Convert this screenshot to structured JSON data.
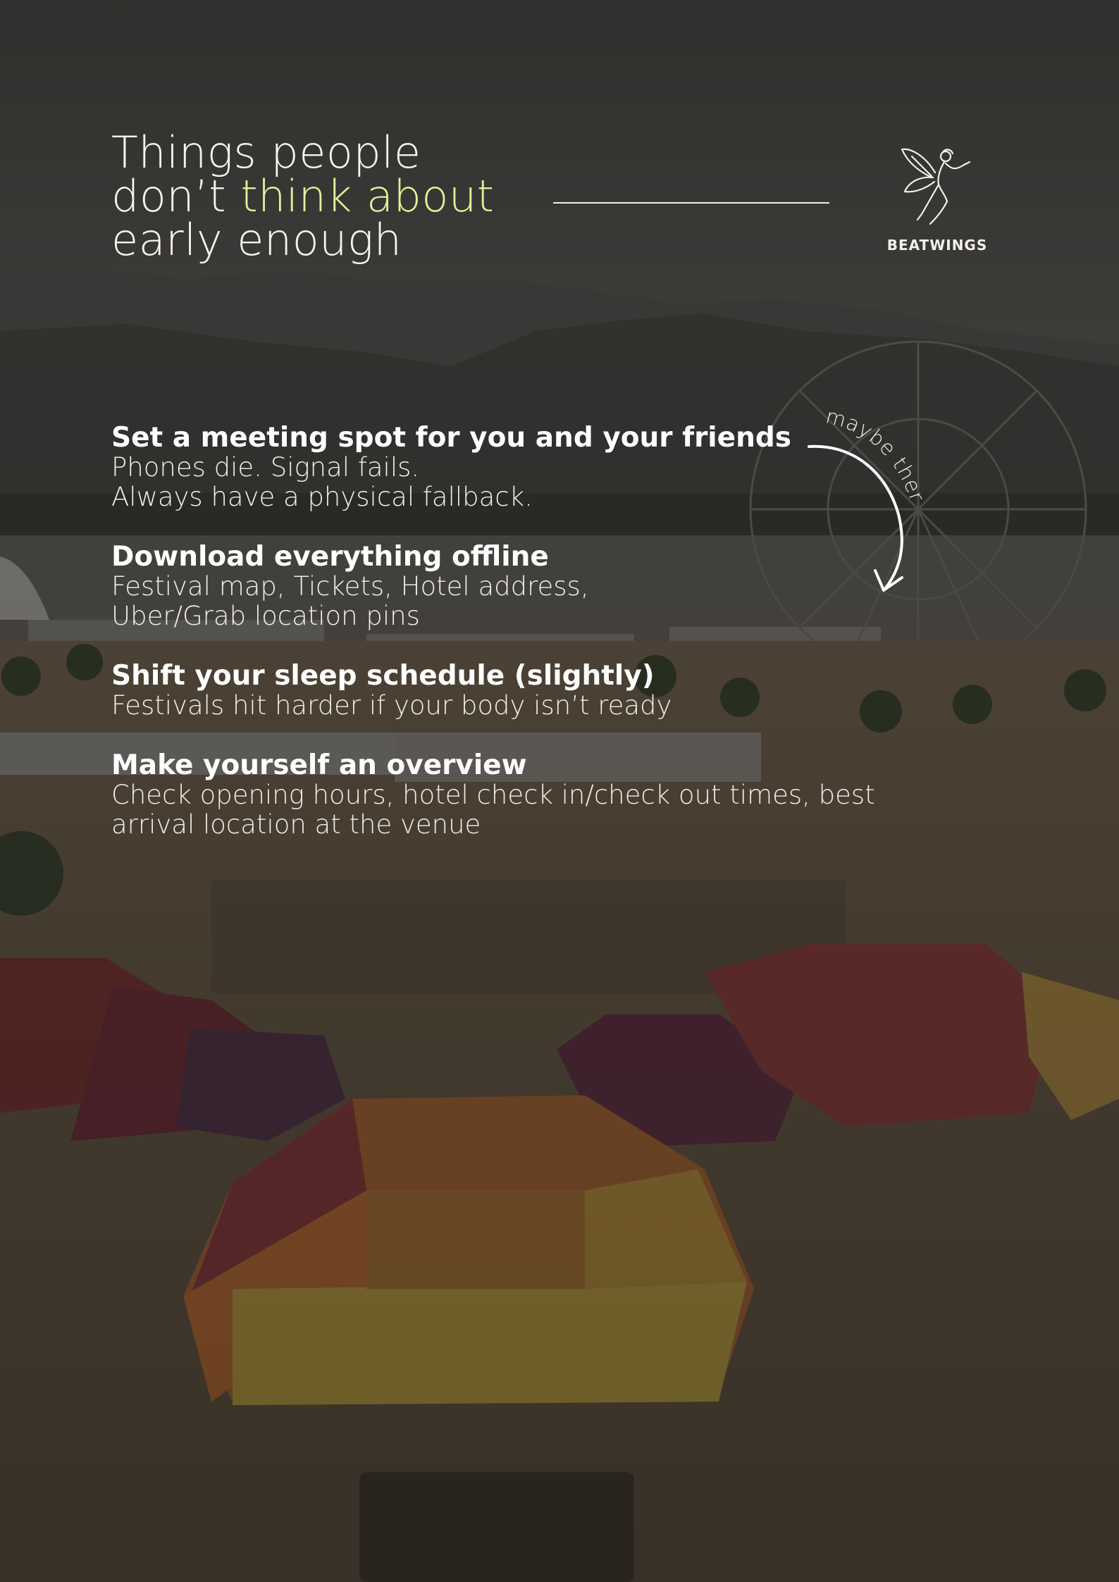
{
  "page": {
    "title_line1": "Things people",
    "title_line2_pre": "don’t ",
    "title_line2_accent": "think about",
    "title_line3": "early enough",
    "accent_color": "#e3f09a",
    "overlay_color": "#1e1d1b"
  },
  "logo": {
    "brand": "BEATWINGS",
    "icon": "fairy-icon"
  },
  "annotation": {
    "text": "maybe there",
    "icon": "curved-arrow-icon"
  },
  "tips": [
    {
      "heading": "Set a meeting spot for you and your friends",
      "lines": [
        "Phones die. Signal fails.",
        "Always have a physical fallback."
      ]
    },
    {
      "heading": "Download everything offline",
      "lines": [
        "Festival map, Tickets, Hotel address,",
        "Uber/Grab location pins"
      ]
    },
    {
      "heading": "Shift your sleep schedule (slightly)",
      "lines": [
        "Festivals hit harder if your body isn’t ready"
      ]
    },
    {
      "heading": "Make yourself an overview",
      "lines": [
        "Check opening hours, hotel check in/check out times, best",
        "arrival location at the venue"
      ]
    }
  ]
}
